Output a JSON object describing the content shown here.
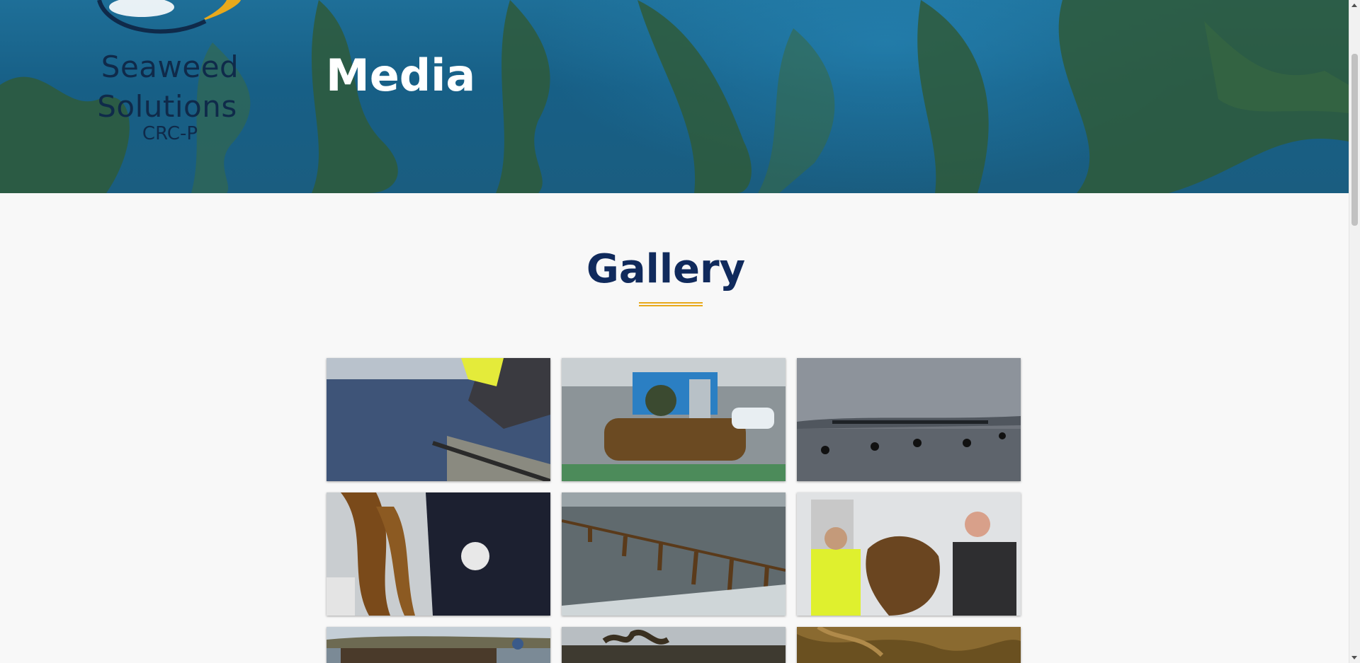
{
  "hero": {
    "title": "Media",
    "background": "underwater-kelp-forest-image"
  },
  "logo": {
    "line1": "Seaweed",
    "line2": "Solutions",
    "line3": "CRC-P"
  },
  "gallery": {
    "title": "Gallery",
    "accent_color": "#e8a91c",
    "title_color": "#102a5c",
    "images": [
      {
        "name": "gallery-image-worker-on-boat"
      },
      {
        "name": "gallery-image-seaweed-roller"
      },
      {
        "name": "gallery-image-sea-farm-buoys"
      },
      {
        "name": "gallery-image-kelp-held-by-imas-shirt"
      },
      {
        "name": "gallery-image-kelp-longline"
      },
      {
        "name": "gallery-image-two-men-holding-kelp"
      },
      {
        "name": "gallery-image-harvest-on-boat"
      },
      {
        "name": "gallery-image-kelp-line-shore"
      },
      {
        "name": "gallery-image-kelp-closeup"
      }
    ]
  }
}
